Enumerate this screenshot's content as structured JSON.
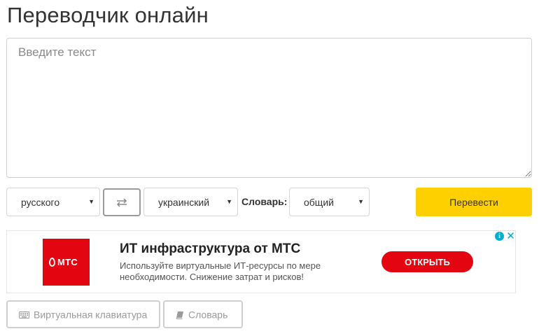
{
  "header": {
    "title": "Переводчик онлайн"
  },
  "input": {
    "placeholder": "Введите текст",
    "value": ""
  },
  "controls": {
    "source_language": "русского",
    "target_language": "украинский",
    "dictionary_label": "Словарь:",
    "dictionary_value": "общий",
    "translate_label": "Перевести"
  },
  "ad": {
    "logo_text": "МТС",
    "title": "ИТ инфраструктура от МТС",
    "description": "Используйте виртуальные ИТ-ресурсы по мере необходимости. Снижение затрат и рисков!",
    "cta_label": "ОТКРЫТЬ",
    "info_glyph": "i",
    "close_glyph": "✕",
    "brand_color": "#e30611",
    "adchoices_color": "#00aecd"
  },
  "tools": {
    "keyboard_label": "Виртуальная клавиатура",
    "dictionary_label": "Словарь"
  },
  "colors": {
    "accent": "#fed000",
    "border": "#d6d6d6",
    "muted_text": "#9a9a9a"
  },
  "icons": {
    "swap": "swap-arrows-icon",
    "keyboard": "keyboard-icon",
    "book": "book-icon",
    "dropdown": "caret-down-icon"
  }
}
